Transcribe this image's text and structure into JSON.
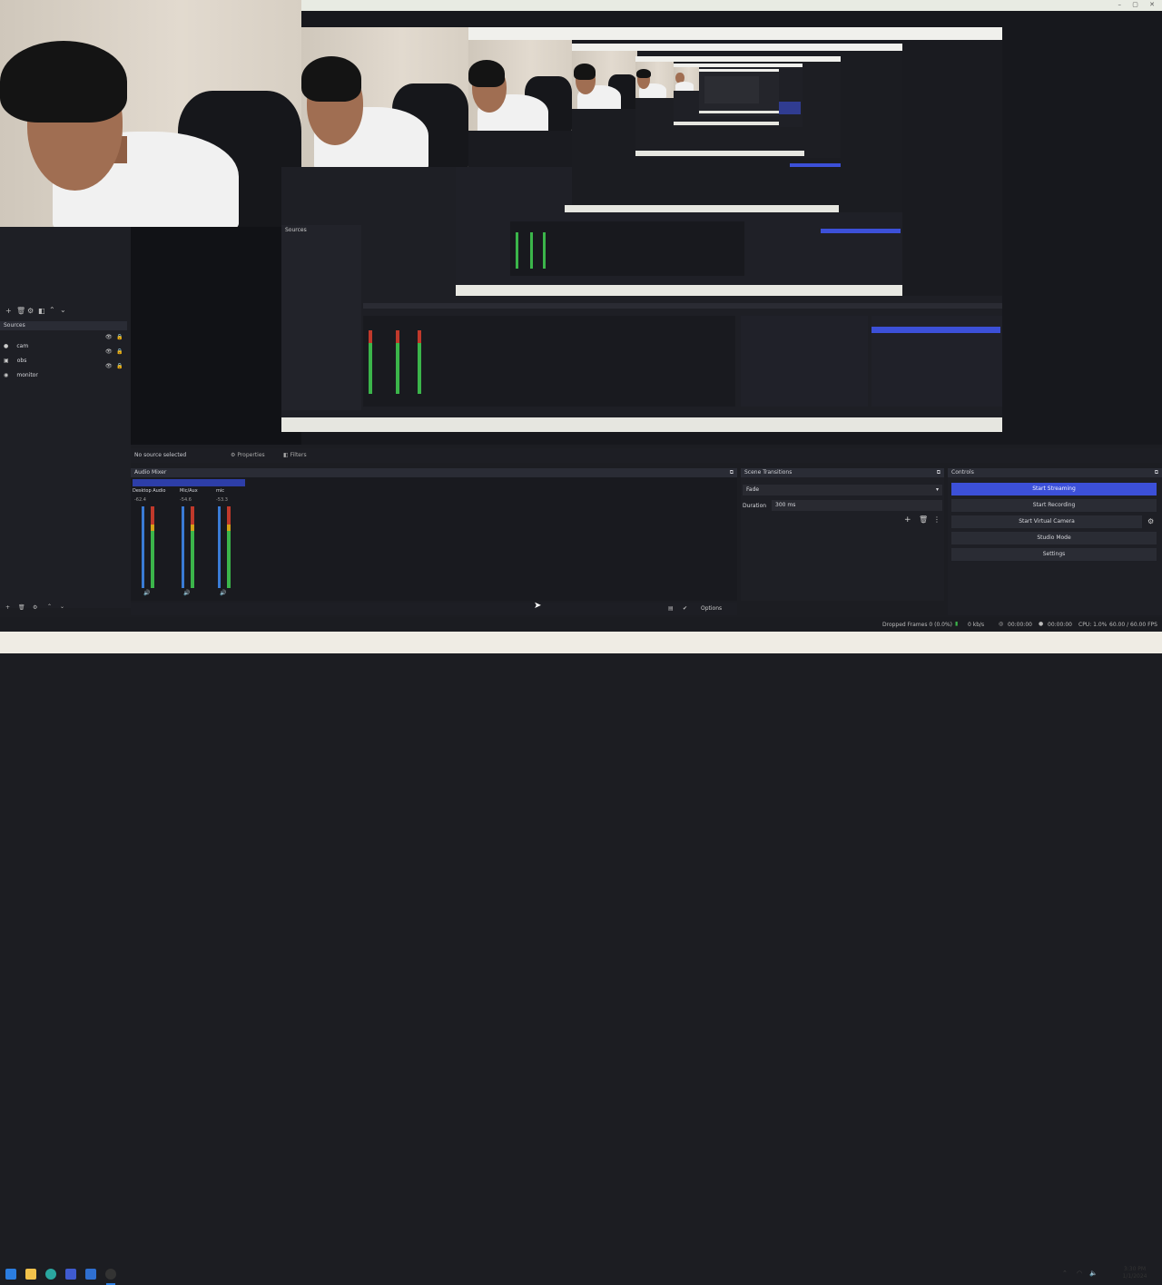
{
  "window": {
    "title_bar_controls": [
      "minimize",
      "maximize",
      "close"
    ]
  },
  "sources_dock": {
    "title": "Sources",
    "items": [
      {
        "label": "cam"
      },
      {
        "label": "obs"
      },
      {
        "label": "monitor"
      }
    ]
  },
  "scene_toolbar": {
    "tabs": [
      "Properties",
      "Filters"
    ],
    "status": "No source selected"
  },
  "audio_mixer": {
    "title": "Audio Mixer",
    "channels": [
      {
        "name": "Desktop Audio",
        "db": "-62.4"
      },
      {
        "name": "Mic/Aux",
        "db": "-54.6"
      },
      {
        "name": "mic",
        "db": "-53.3"
      }
    ]
  },
  "scene_transitions": {
    "title": "Scene Transitions",
    "transition": "Fade",
    "duration_label": "Duration",
    "duration_value": "300 ms"
  },
  "controls": {
    "title": "Controls",
    "start_streaming": "Start Streaming",
    "start_recording": "Start Recording",
    "start_virtual_camera": "Start Virtual Camera",
    "studio_mode": "Studio Mode",
    "settings": "Settings"
  },
  "mixer_footer": {
    "options_label": "Options"
  },
  "status_bar": {
    "dropped": "Dropped Frames 0 (0.0%)",
    "bitrate": "0 kb/s",
    "stream_time": "00:00:00",
    "rec_time": "00:00:00",
    "cpu": "CPU: 1.0%",
    "fps": "60.00 / 60.00 FPS"
  },
  "taskbar": {
    "clock_time": "3:30 PM",
    "clock_date": "1/1/2024"
  },
  "colors": {
    "accent_blue": "#3c50d8",
    "meter_green": "#3bb54a",
    "meter_red": "#c0392b",
    "panel_bg": "#1f2027"
  }
}
